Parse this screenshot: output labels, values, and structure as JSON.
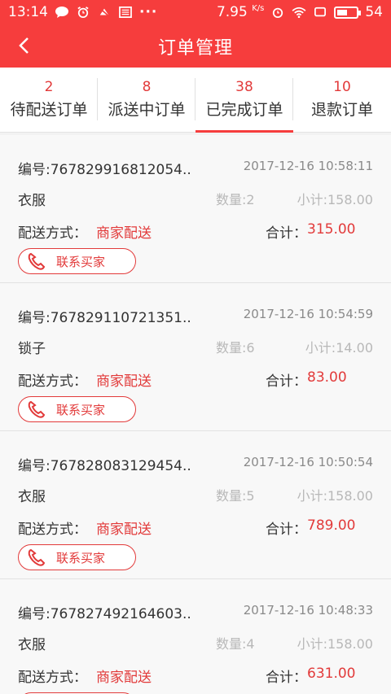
{
  "status_bar": {
    "time": "13:14",
    "speed": "7.95",
    "speed_unit": "K/s",
    "battery": "54",
    "battery_level": 0.54
  },
  "header": {
    "title": "订单管理"
  },
  "tabs": [
    {
      "count": "2",
      "label": "待配送订单"
    },
    {
      "count": "8",
      "label": "派送中订单"
    },
    {
      "count": "38",
      "label": "已完成订单"
    },
    {
      "count": "10",
      "label": "退款订单"
    }
  ],
  "active_tab": 2,
  "labels": {
    "delivery": "配送方式：",
    "total": "合计：",
    "contact": "联系买家"
  },
  "orders": [
    {
      "no": "编号:767829916812054..",
      "time": "2017-12-16 10:58:11",
      "goods": "衣服",
      "qty": "数量:2",
      "subtotal": "小计:158.00",
      "delivery": "商家配送",
      "total": "315.00"
    },
    {
      "no": "编号:767829110721351..",
      "time": "2017-12-16 10:54:59",
      "goods": "锁子",
      "qty": "数量:6",
      "subtotal": "小计:14.00",
      "delivery": "商家配送",
      "total": "83.00"
    },
    {
      "no": "编号:767828083129454..",
      "time": "2017-12-16 10:50:54",
      "goods": "衣服",
      "qty": "数量:5",
      "subtotal": "小计:158.00",
      "delivery": "商家配送",
      "total": "789.00"
    },
    {
      "no": "编号:767827492164603..",
      "time": "2017-12-16 10:48:33",
      "goods": "衣服",
      "qty": "数量:4",
      "subtotal": "小计:158.00",
      "delivery": "商家配送",
      "total": "631.00"
    }
  ],
  "colors": {
    "brand_red": "#f63d3d",
    "accent_red": "#e23a3a"
  }
}
